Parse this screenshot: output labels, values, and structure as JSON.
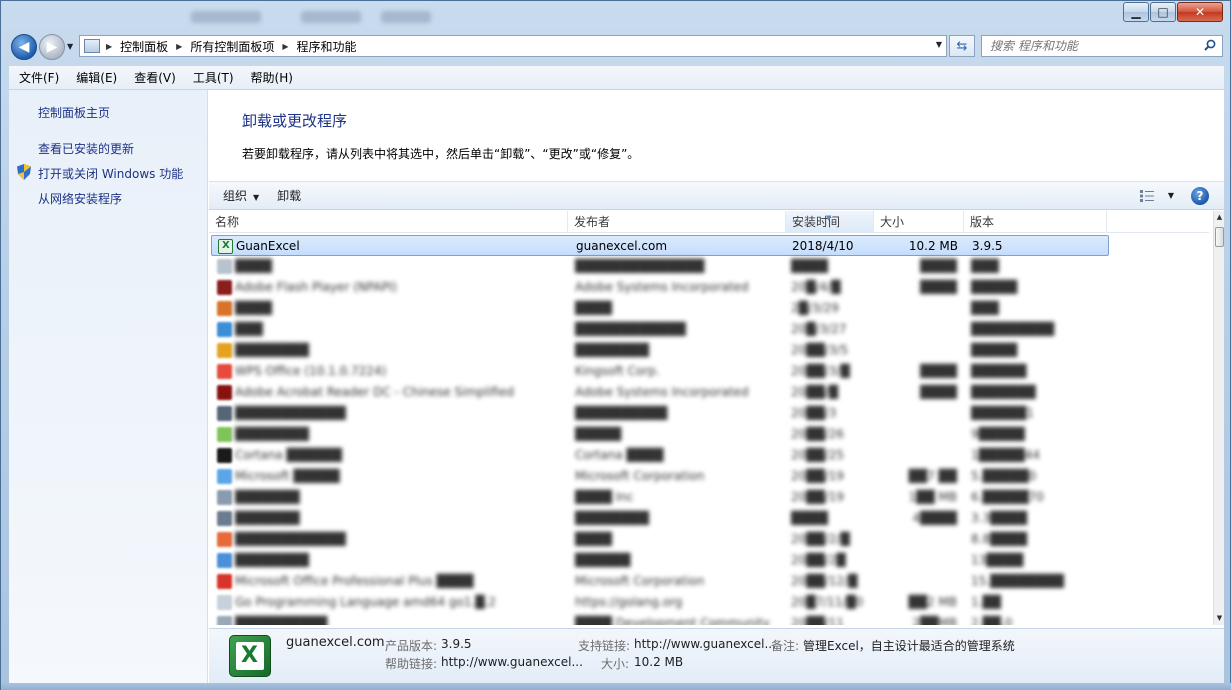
{
  "address": {
    "crumbs": [
      "控制面板",
      "所有控制面板项",
      "程序和功能"
    ],
    "search_placeholder": "搜索 程序和功能"
  },
  "menu": [
    "文件(F)",
    "编辑(E)",
    "查看(V)",
    "工具(T)",
    "帮助(H)"
  ],
  "sidebar": {
    "links": [
      "控制面板主页",
      "查看已安装的更新",
      "打开或关闭 Windows 功能",
      "从网络安装程序"
    ]
  },
  "main": {
    "title": "卸载或更改程序",
    "description": "若要卸载程序，请从列表中将其选中，然后单击“卸载”、“更改”或“修复”。"
  },
  "toolbar": {
    "organize": "组织",
    "uninstall": "卸载"
  },
  "columns": [
    "名称",
    "发布者",
    "安装时间",
    "大小",
    "版本"
  ],
  "programs": [
    {
      "name": "GuanExcel",
      "publisher": "guanexcel.com",
      "date": "2018/4/10",
      "size": "10.2 MB",
      "version": "3.9.5",
      "selected": true
    },
    {
      "name": "████",
      "publisher": "██████████████",
      "date": "████",
      "size": "████",
      "version": "███"
    },
    {
      "name": "Adobe Flash Player (NPAPI)",
      "publisher": "Adobe Systems Incorporated",
      "date": "20█/4/█",
      "size": "████",
      "version": "█████"
    },
    {
      "name": "████",
      "publisher": "████",
      "date": "2█/3/29",
      "size": "",
      "version": "███"
    },
    {
      "name": "███",
      "publisher": "████████████",
      "date": "20█/3/27",
      "size": "",
      "version": "█████████"
    },
    {
      "name": "████████",
      "publisher": "████████",
      "date": "20██/3/5",
      "size": "",
      "version": "█████"
    },
    {
      "name": "WPS Office (10.1.0.7224)",
      "publisher": "Kingsoft Corp.",
      "date": "20██/3/█",
      "size": "████",
      "version": "██████"
    },
    {
      "name": "Adobe Acrobat Reader DC - Chinese Simplified",
      "publisher": "Adobe Systems Incorporated",
      "date": "20██/█",
      "size": "████",
      "version": "███████"
    },
    {
      "name": "████████████",
      "publisher": "██████████",
      "date": "20██/3",
      "size": "",
      "version": "██████1"
    },
    {
      "name": "████████",
      "publisher": "█████",
      "date": "20██/26",
      "size": "",
      "version": "9█████"
    },
    {
      "name": "Cortana ██████",
      "publisher": "Cortana ████",
      "date": "20██/25",
      "size": "",
      "version": "1█████44"
    },
    {
      "name": "Microsoft █████",
      "publisher": "Microsoft Corporation",
      "date": "20██/19",
      "size": "██7 ██",
      "version": "5.█████0"
    },
    {
      "name": "███████",
      "publisher": "████ Inc",
      "date": "20██/19",
      "size": "1██ MB",
      "version": "6.█████70"
    },
    {
      "name": "███████",
      "publisher": "████████",
      "date": "████",
      "size": "4████",
      "version": "3.3████"
    },
    {
      "name": "████████████",
      "publisher": "████",
      "date": "20██/2/█",
      "size": "",
      "version": "8.8████"
    },
    {
      "name": "████████",
      "publisher": "██████",
      "date": "20██/2█",
      "size": "",
      "version": "13████"
    },
    {
      "name": "Microsoft Office Professional Plus ████",
      "publisher": "Microsoft Corporation",
      "date": "20██/12/█",
      "size": "",
      "version": "15.████████"
    },
    {
      "name": "Go Programming Language amd64 go1.█.2",
      "publisher": "https://golang.org",
      "date": "20█7/11/█0",
      "size": "██2 MB",
      "version": "1.██"
    },
    {
      "name": "██████████",
      "publisher": "████ Development Community",
      "date": "20██/11",
      "size": "2██MB",
      "version": "2.██.0"
    }
  ],
  "details": {
    "name": "guanexcel.com",
    "product_version_label": "产品版本:",
    "product_version": "3.9.5",
    "support_link_label": "支持链接:",
    "support_link": "http://www.guanexcel...",
    "comment_label": "备注:",
    "comment": "管理Excel，自主设计最适合的管理系统",
    "help_link_label": "帮助链接:",
    "help_link": "http://www.guanexcel...",
    "size_label": "大小:",
    "size": "10.2 MB"
  },
  "icons": {
    "row_colors": [
      "#1e7a32",
      "#b8c3cf",
      "#8a1d1d",
      "#d9732a",
      "#3b8fd8",
      "#e3a320",
      "#e64a3c",
      "#8a1010",
      "#556677",
      "#7fc45a",
      "#1a1a1a",
      "#5aa7e8",
      "#8a9bb0",
      "#6a7c90",
      "#e86a3a",
      "#4a90d9",
      "#d9342b",
      "#c7d1db",
      "#9aa8b8"
    ]
  }
}
